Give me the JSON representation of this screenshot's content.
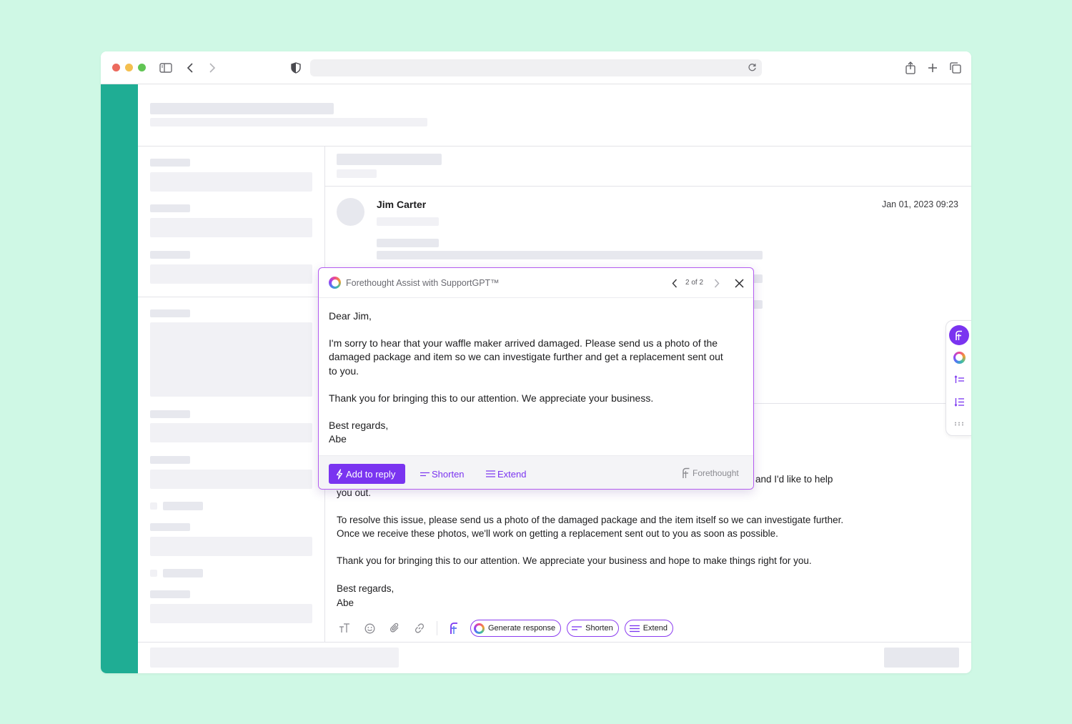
{
  "colors": {
    "background": "#cff8e5",
    "sidebar": "#1fad94",
    "accent": "#7a34f0",
    "popup_border": "#b45cf0"
  },
  "browser": {
    "url": ""
  },
  "message": {
    "sender": "Jim Carter",
    "timestamp": "Jan 01, 2023 09:23"
  },
  "reply": {
    "line1_tail": "and I'd like to help",
    "line2": "you out.",
    "para2_line1": "To resolve this issue, please send us a photo of the damaged package and the item itself so we can investigate further.",
    "para2_line2": "Once we receive these photos, we'll work on getting a replacement sent out to you as soon as possible.",
    "para3": "Thank you for bringing this to our attention.  We appreciate your business and hope to make things right for you.",
    "signoff": "Best regards,",
    "signature": "Abe"
  },
  "composer": {
    "generate_label": "Generate response",
    "shorten_label": "Shorten",
    "extend_label": "Extend"
  },
  "popup": {
    "title": "Forethought Assist with SupportGPT™",
    "pager": "2 of 2",
    "greeting": "Dear Jim,",
    "para1_line1": "I'm sorry to hear that your waffle maker arrived damaged. Please send us a photo of the",
    "para1_line2": "damaged package and item so we can investigate further and get a replacement sent out",
    "para1_line3": "to you.",
    "para2": "Thank you for bringing this to our attention. We appreciate your business.",
    "signoff": "Best regards,",
    "signature": "Abe",
    "add_label": "Add to reply",
    "shorten_label": "Shorten",
    "extend_label": "Extend",
    "brand": "Forethought"
  },
  "icons": [
    "sidebar-toggle-icon",
    "back-icon",
    "forward-icon",
    "shield-icon",
    "reload-icon",
    "share-icon",
    "new-tab-icon",
    "tabs-icon",
    "text-format-icon",
    "emoji-icon",
    "attach-icon",
    "link-icon",
    "forethought-icon",
    "close-icon",
    "lightning-icon"
  ]
}
